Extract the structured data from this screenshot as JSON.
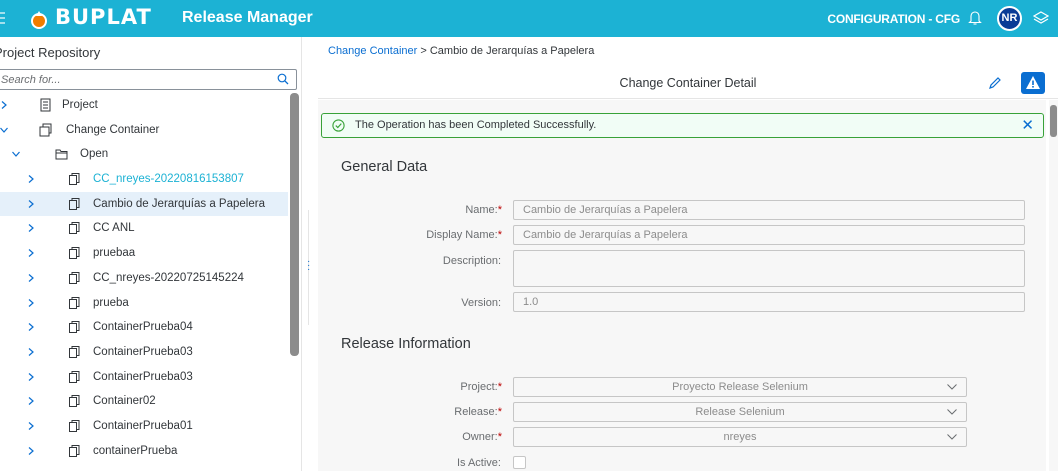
{
  "header": {
    "logo_text": "BUPLAT",
    "app_title": "Release Manager",
    "environment": "CONFIGURATION - CFG",
    "user_initials": "NR",
    "brand_color": "#1cb2d4"
  },
  "left_panel": {
    "title": "Project Repository",
    "search_placeholder": "Search for...",
    "tree": [
      {
        "label": "Project",
        "level": 0,
        "expanded": false,
        "icon": "project-icon"
      },
      {
        "label": "Change Container",
        "level": 0,
        "expanded": true,
        "icon": "change-container-icon"
      },
      {
        "label": "Open",
        "level": 1,
        "expanded": true,
        "icon": "folder-open-icon"
      },
      {
        "label": "CC_nreyes-20220816153807",
        "level": 2,
        "expanded": false,
        "icon": "copy-icon",
        "link": true
      },
      {
        "label": "Cambio de Jerarquías a Papelera",
        "level": 2,
        "expanded": false,
        "icon": "copy-icon",
        "selected": true
      },
      {
        "label": "CC ANL",
        "level": 2,
        "expanded": false,
        "icon": "copy-icon"
      },
      {
        "label": "pruebaa",
        "level": 2,
        "expanded": false,
        "icon": "copy-icon"
      },
      {
        "label": "CC_nreyes-20220725145224",
        "level": 2,
        "expanded": false,
        "icon": "copy-icon"
      },
      {
        "label": "prueba",
        "level": 2,
        "expanded": false,
        "icon": "copy-icon"
      },
      {
        "label": "ContainerPrueba04",
        "level": 2,
        "expanded": false,
        "icon": "copy-icon"
      },
      {
        "label": "ContainerPrueba03",
        "level": 2,
        "expanded": false,
        "icon": "copy-icon"
      },
      {
        "label": "ContainerPrueba03",
        "level": 2,
        "expanded": false,
        "icon": "copy-icon"
      },
      {
        "label": "Container02",
        "level": 2,
        "expanded": false,
        "icon": "copy-icon"
      },
      {
        "label": "ContainerPrueba01",
        "level": 2,
        "expanded": false,
        "icon": "copy-icon"
      },
      {
        "label": "containerPrueba",
        "level": 2,
        "expanded": false,
        "icon": "copy-icon"
      }
    ]
  },
  "breadcrumb": {
    "link": "Change Container",
    "separator": " > ",
    "current": "Cambio de Jerarquías a Papelera"
  },
  "detail": {
    "title": "Change Container Detail"
  },
  "message": {
    "text": "The Operation has been Completed Successfully."
  },
  "general_data": {
    "title": "General Data",
    "name_label": "Name:",
    "name_value": "Cambio de Jerarquías a Papelera",
    "display_name_label": "Display Name:",
    "display_name_value": "Cambio de Jerarquías a Papelera",
    "description_label": "Description:",
    "description_value": "",
    "version_label": "Version:",
    "version_value": "1.0"
  },
  "release_info": {
    "title": "Release Information",
    "project_label": "Project:",
    "project_value": "Proyecto Release Selenium",
    "release_label": "Release:",
    "release_value": "Release Selenium",
    "owner_label": "Owner:",
    "owner_value": "nreyes",
    "is_active_label": "Is Active:"
  },
  "required_marker": "*"
}
